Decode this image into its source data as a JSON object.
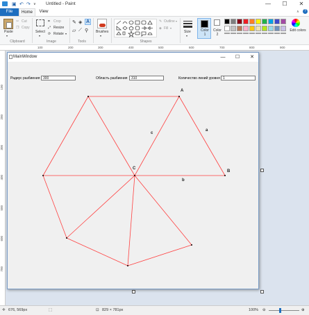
{
  "window": {
    "title": "Untitled - Paint",
    "minimize": "—",
    "maximize": "☐",
    "close": "✕"
  },
  "tabs": {
    "file": "File",
    "home": "Home",
    "view": "View"
  },
  "clipboard": {
    "paste": "Paste",
    "cut": "Cut",
    "copy": "Copy",
    "group": "Clipboard"
  },
  "image": {
    "select": "Select",
    "crop": "Crop",
    "resize": "Resize",
    "rotate": "Rotate",
    "group": "Image"
  },
  "tools": {
    "group": "Tools"
  },
  "brushes": {
    "label": "Brushes"
  },
  "shapes": {
    "outline": "Outline",
    "fill": "Fill",
    "group": "Shapes"
  },
  "size": {
    "label": "Size"
  },
  "colors": {
    "color1": "Color 1",
    "color2": "Color 2",
    "edit": "Edit colors",
    "swatches": [
      "#000000",
      "#7f7f7f",
      "#880015",
      "#ed1c24",
      "#ff7f27",
      "#fff200",
      "#22b14c",
      "#00a2e8",
      "#3f48cc",
      "#a349a4",
      "#ffffff",
      "#c3c3c3",
      "#b97a57",
      "#ffaec9",
      "#ffc90e",
      "#efe4b0",
      "#b5e61d",
      "#99d9ea",
      "#7092be",
      "#c8bfe7"
    ]
  },
  "ruler_top": [
    "100",
    "200",
    "300",
    "400",
    "500",
    "600",
    "700",
    "800",
    "900"
  ],
  "ruler_left": [
    "100",
    "200",
    "300",
    "400",
    "500",
    "600",
    "700"
  ],
  "mainwindow": {
    "title": "MainWindow",
    "minimize": "—",
    "maximize": "☐",
    "close": "✕",
    "radius_label": "Радиус разбиения",
    "radius_value": "300",
    "area_label": "Область разбиения",
    "area_value": "310",
    "lines_label": "Количество линий уровня",
    "lines_value": "1"
  },
  "drawing": {
    "labels": {
      "A": "A",
      "B": "B",
      "C": "C",
      "a": "a",
      "b": "b",
      "c": "c"
    },
    "line_color": "#ff4040"
  },
  "status": {
    "cursor": "676, 569px",
    "size": "829 × 781px",
    "zoom": "100%"
  }
}
